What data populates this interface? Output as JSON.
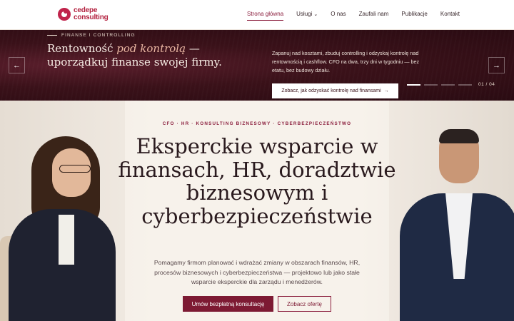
{
  "nav": {
    "logo_line1": "cedepe",
    "logo_line2": "consulting",
    "links": [
      {
        "label": "Strona główna",
        "active": true
      },
      {
        "label": "Usługi",
        "has_dropdown": true
      },
      {
        "label": "O nas"
      },
      {
        "label": "Zaufali nam"
      },
      {
        "label": "Publikacje"
      },
      {
        "label": "Kontakt"
      }
    ]
  },
  "slider": {
    "eyebrow": "FINANSE I CONTROLLING",
    "title_part1": "Rentowność ",
    "title_em": "pod kontrolą",
    "title_part2": " — uporządkuj finanse swojej firmy.",
    "description": "Zapanuj nad kosztami, zbuduj controlling i odzyskaj kontrolę nad rentownością i cashflow. CFO na dwa, trzy dni w tygodniu — bez etatu, bez budowy działu.",
    "cta_label": "Zobacz, jak odzyskać kontrolę nad finansami",
    "counter": "01 / 04",
    "active_slide": 1,
    "total_slides": 4,
    "prev_icon": "arrow-left-icon",
    "next_icon": "arrow-right-icon"
  },
  "hero": {
    "eyebrow": "CFO · HR · KONSULTING BIZNESOWY · CYBERBEZPIECZEŃSTWO",
    "title": "Eksperckie wsparcie w finansach, HR, doradztwie biznesowym i cyberbezpieczeństwie",
    "description": "Pomagamy firmom planować i wdrażać zmiany w obszarach finansów, HR, procesów biznesowych i cyberbezpieczeństwa — projektowo lub jako stałe wsparcie eksperckie dla zarządu i menedżerów.",
    "primary_cta": "Umów bezpłatną konsultację",
    "secondary_cta": "Zobacz ofertę"
  },
  "colors": {
    "brand": "#b3213f",
    "accent": "#7d1a33",
    "slider_bg": "#3a1119"
  }
}
